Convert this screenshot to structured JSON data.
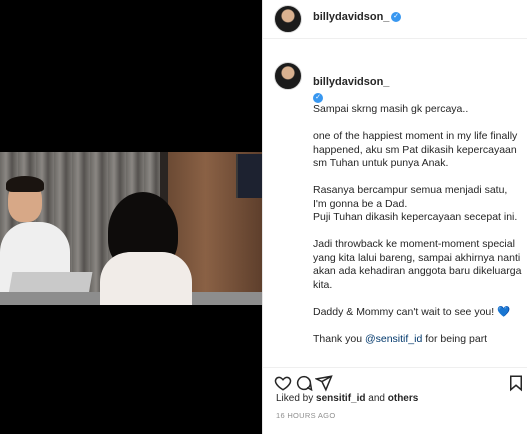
{
  "post": {
    "username": "billydavidson_",
    "verified_icon": "verified-badge-icon",
    "caption_paragraphs": [
      "one of the happiest moment in my life finally happened, aku sm Pat dikasih kepercayaan sm Tuhan untuk punya Anak.",
      "Rasanya bercampur semua menjadi satu, I'm gonna be a Dad.\nPuji Tuhan dikasih kepercayaan secepat ini.",
      "Jadi throwback ke moment-moment special yang kita lalui bareng, sampai akhirnya nanti akan ada kehadiran anggota baru dikeluarga kita.",
      "Daddy & Mommy can't wait to see you!"
    ],
    "caption_first_line": "Sampai skrng masih gk percaya..",
    "caption_last_line_prefix": "Thank you ",
    "caption_last_line_mention": "@sensitif_id",
    "caption_last_line_suffix": " for being part",
    "heart_glyph": "💙",
    "liked_by_prefix": "Liked by ",
    "liked_by_user": "sensitif_id",
    "liked_by_suffix": " and ",
    "liked_by_others": "others",
    "timestamp": "16 HOURS AGO"
  },
  "colors": {
    "accent": "#3897f0",
    "text": "#262626",
    "muted": "#8e8e8e"
  }
}
